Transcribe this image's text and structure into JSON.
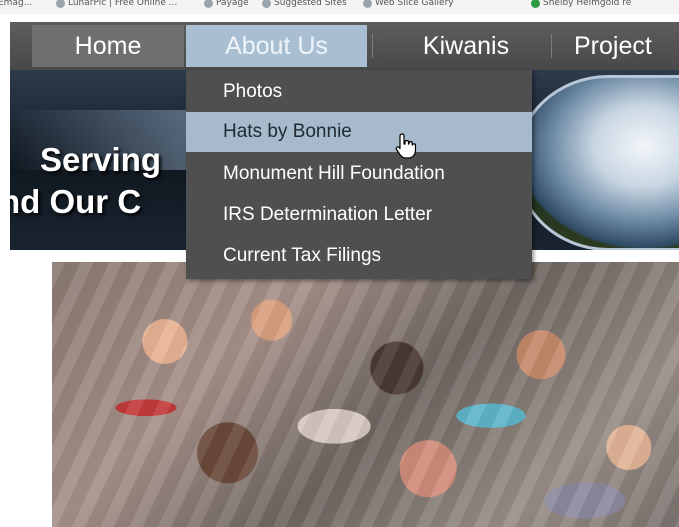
{
  "bookmarks": [
    {
      "label": "Emag...",
      "icon": "bookmark-icon"
    },
    {
      "label": "LunarPic | Free Online ...",
      "icon": "bookmark-icon"
    },
    {
      "label": "Payage",
      "icon": "bookmark-icon"
    },
    {
      "label": "Suggested Sites",
      "icon": "bookmark-icon"
    },
    {
      "label": "Web Slice Gallery",
      "icon": "bookmark-icon"
    },
    {
      "label": "Shelby Helmgold re",
      "icon": "google-icon"
    }
  ],
  "nav": {
    "items": [
      "Home",
      "About Us",
      "Kiwanis",
      "Project"
    ],
    "active": "About Us"
  },
  "hero": {
    "line1": "Serving",
    "line2": "nd Our C"
  },
  "dropdown": {
    "items": [
      "Photos",
      "Hats by Bonnie",
      "Monument Hill Foundation",
      "IRS Determination Letter",
      "Current Tax Filings"
    ],
    "hovered": "Hats by Bonnie"
  },
  "colors": {
    "nav_bg": "#4f4f4f",
    "nav_active": "#a9bed1",
    "dropdown_bg": "#4f4f4f",
    "dropdown_hover": "#a6bacb"
  }
}
